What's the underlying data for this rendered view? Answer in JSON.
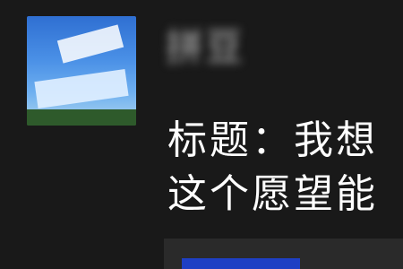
{
  "message": {
    "sender_name": "拼豆",
    "line1": "标题：我想",
    "line2": "这个愿望能"
  },
  "icons": {
    "avatar": "profile-photo-sky"
  },
  "colors": {
    "background": "#191919",
    "text": "#ffffff",
    "card": "#2a2a2a",
    "accent": "#1e3fc4"
  }
}
